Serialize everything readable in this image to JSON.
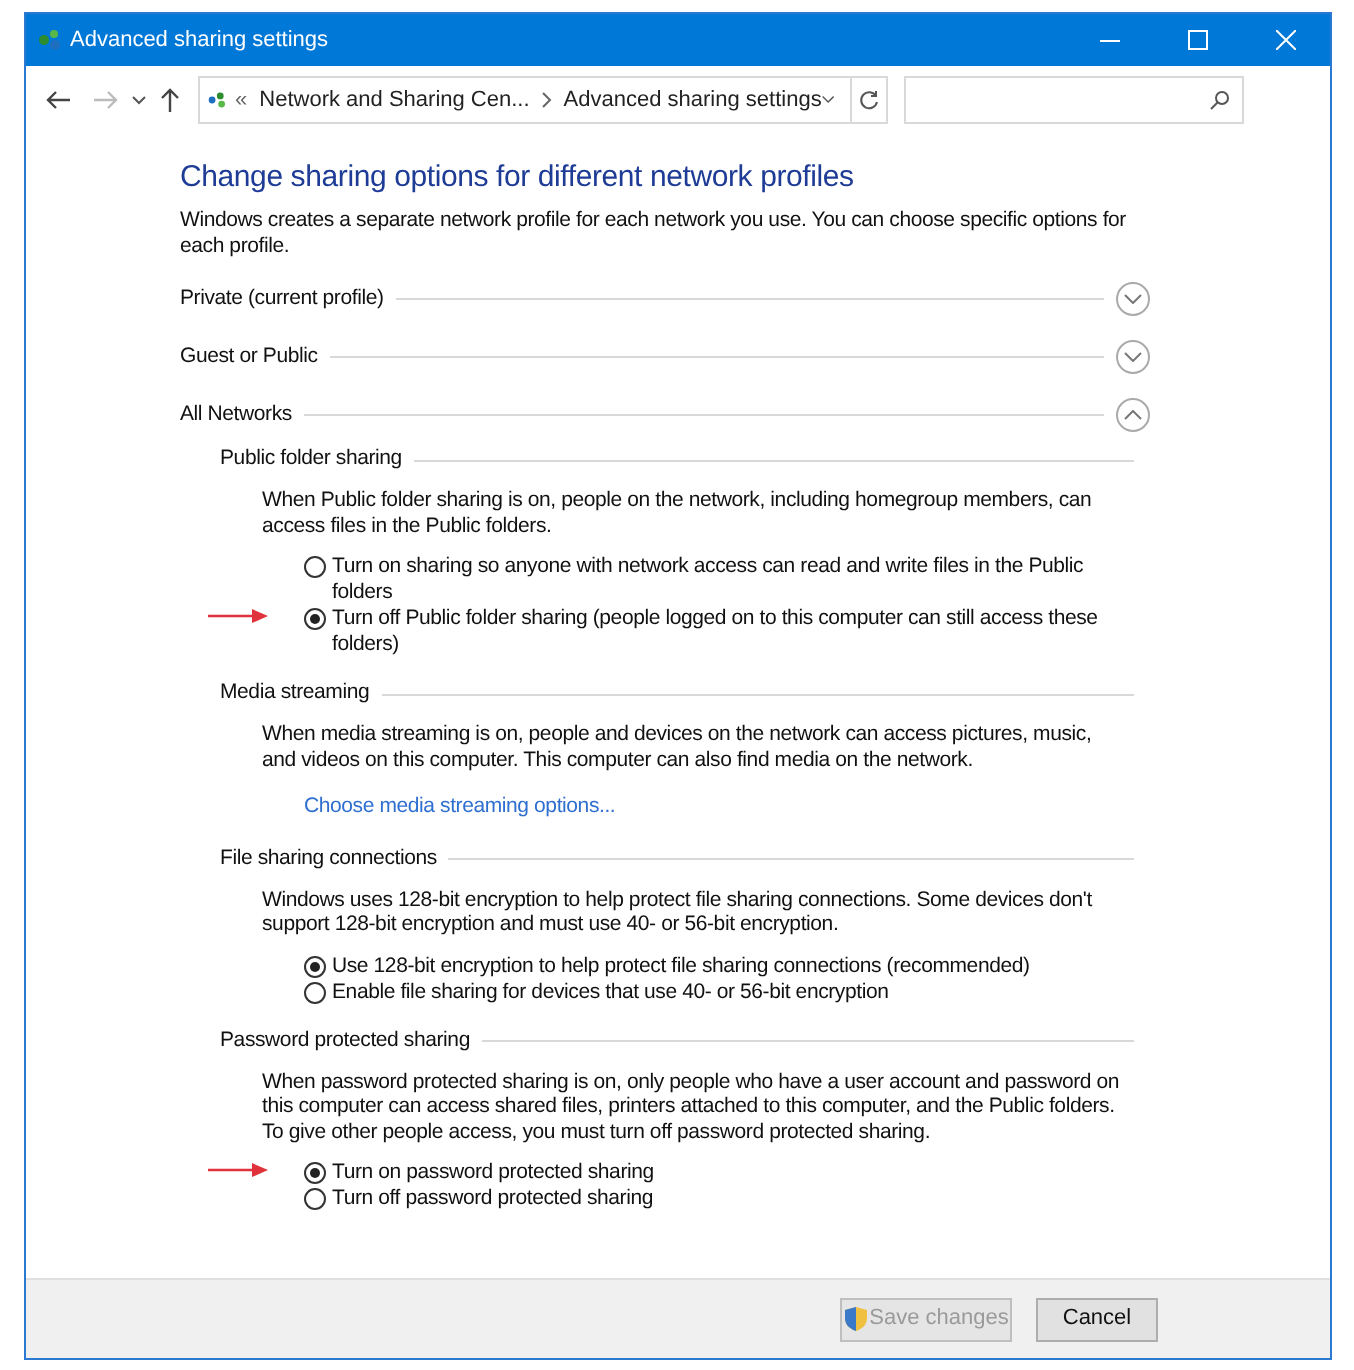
{
  "window": {
    "title": "Advanced sharing settings"
  },
  "nav": {
    "back_disabled": false,
    "forward_disabled": true,
    "breadcrumbs": [
      "«",
      "Network and Sharing Cen...",
      "Advanced sharing settings"
    ]
  },
  "heading": "Change sharing options for different network profiles",
  "intro": "Windows creates a separate network profile for each network you use. You can choose specific options for each profile.",
  "profiles": [
    {
      "label": "Private (current profile)",
      "expanded": false
    },
    {
      "label": "Guest or Public",
      "expanded": false
    },
    {
      "label": "All Networks",
      "expanded": true
    }
  ],
  "sections": [
    {
      "title": "Public folder sharing",
      "description": "When Public folder sharing is on, people on the network, including homegroup members, can access files in the Public folders.",
      "options": [
        {
          "label": "Turn on sharing so anyone with network access can read and write files in the Public folders",
          "selected": false,
          "arrow": false
        },
        {
          "label": "Turn off Public folder sharing (people logged on to this computer can still access these folders)",
          "selected": true,
          "arrow": true
        }
      ]
    },
    {
      "title": "Media streaming",
      "description": "When media streaming is on, people and devices on the network can access pictures, music, and videos on this computer. This computer can also find media on the network.",
      "link": "Choose media streaming options..."
    },
    {
      "title": "File sharing connections",
      "description": "Windows uses 128-bit encryption to help protect file sharing connections. Some devices don't support 128-bit encryption and must use 40- or 56-bit encryption.",
      "options": [
        {
          "label": "Use 128-bit encryption to help protect file sharing connections (recommended)",
          "selected": true,
          "arrow": false
        },
        {
          "label": "Enable file sharing for devices that use 40- or 56-bit encryption",
          "selected": false,
          "arrow": false
        }
      ]
    },
    {
      "title": "Password protected sharing",
      "description": "When password protected sharing is on, only people who have a user account and password on this computer can access shared files, printers attached to this computer, and the Public folders. To give other people access, you must turn off password protected sharing.",
      "options": [
        {
          "label": "Turn on password protected sharing",
          "selected": true,
          "arrow": true
        },
        {
          "label": "Turn off password protected sharing",
          "selected": false,
          "arrow": false
        }
      ]
    }
  ],
  "buttons": [
    {
      "kind": "shield",
      "label": "Save changes",
      "disabled": true
    },
    {
      "kind": "plain",
      "label": "Cancel",
      "disabled": false
    }
  ]
}
